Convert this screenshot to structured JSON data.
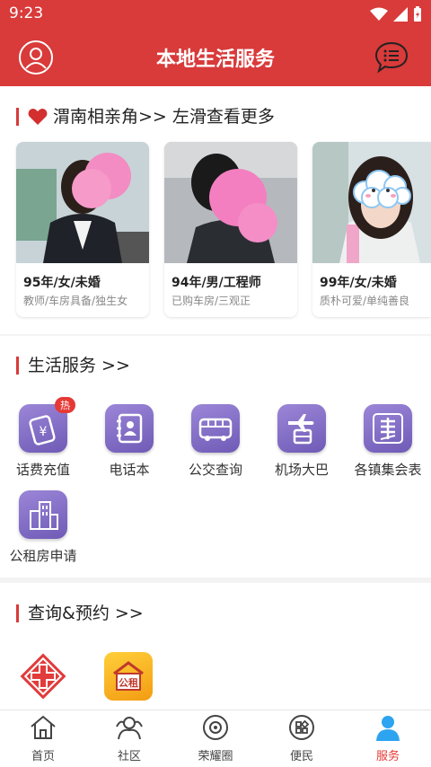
{
  "status": {
    "time": "9:23"
  },
  "header": {
    "title": "本地生活服务"
  },
  "match": {
    "title": "渭南相亲角>> 左滑查看更多",
    "cards": [
      {
        "title": "95年/女/未婚",
        "sub": "教师/车房具备/独生女"
      },
      {
        "title": "94年/男/工程师",
        "sub": "已购车房/三观正"
      },
      {
        "title": "99年/女/未婚",
        "sub": "质朴可爱/单纯善良"
      }
    ]
  },
  "life": {
    "title": "生活服务 >>",
    "hot_badge": "热",
    "items": [
      {
        "label": "话费充值",
        "icon": "phone-yuan-icon"
      },
      {
        "label": "电话本",
        "icon": "contacts-book-icon"
      },
      {
        "label": "公交查询",
        "icon": "bus-icon"
      },
      {
        "label": "机场大巴",
        "icon": "airport-bus-icon"
      },
      {
        "label": "各镇集会表",
        "icon": "ji-market-icon"
      },
      {
        "label": "公租房申请",
        "icon": "buildings-icon"
      }
    ]
  },
  "booking": {
    "title": "查询&预约 >>",
    "items": [
      {
        "icon": "hospital-cross-icon"
      },
      {
        "icon": "public-housing-icon",
        "text": "公租"
      }
    ]
  },
  "tabs": [
    {
      "label": "首页",
      "icon": "home-icon"
    },
    {
      "label": "社区",
      "icon": "community-icon"
    },
    {
      "label": "荣耀圈",
      "icon": "honor-circle-icon"
    },
    {
      "label": "便民",
      "icon": "grid-icon"
    },
    {
      "label": "服务",
      "icon": "person-icon",
      "active": true
    }
  ],
  "colors": {
    "brand": "#d93a3a",
    "active_tab": "#e53935",
    "icon_purple": "#7b67c2"
  }
}
